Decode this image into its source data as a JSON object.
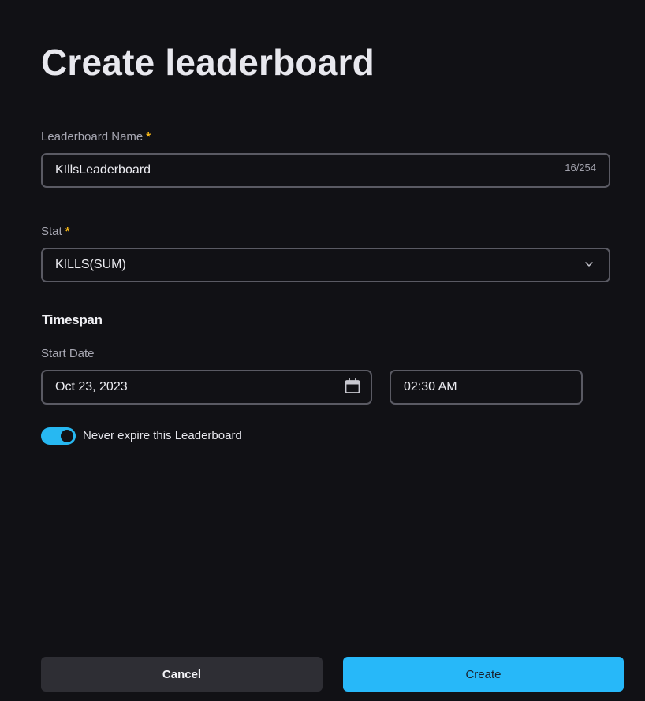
{
  "page": {
    "title": "Create leaderboard"
  },
  "leaderboard_name": {
    "label": "Leaderboard Name",
    "required_marker": "*",
    "value": "KIllsLeaderboard",
    "counter": "16/254"
  },
  "stat": {
    "label": "Stat",
    "required_marker": "*",
    "selected": "KILLS(SUM)",
    "icon": "chevron-down-icon"
  },
  "timespan": {
    "section_title": "Timespan",
    "start_date_label": "Start Date",
    "start_date_value": "Oct 23, 2023",
    "start_time_value": "02:30 AM",
    "date_icon": "calendar-icon"
  },
  "expiry": {
    "toggle_on": true,
    "label": "Never expire this Leaderboard"
  },
  "actions": {
    "cancel_label": "Cancel",
    "create_label": "Create"
  },
  "colors": {
    "background": "#111115",
    "accent": "#27b8f9",
    "required": "#f5b617",
    "border": "#5a5a63"
  }
}
